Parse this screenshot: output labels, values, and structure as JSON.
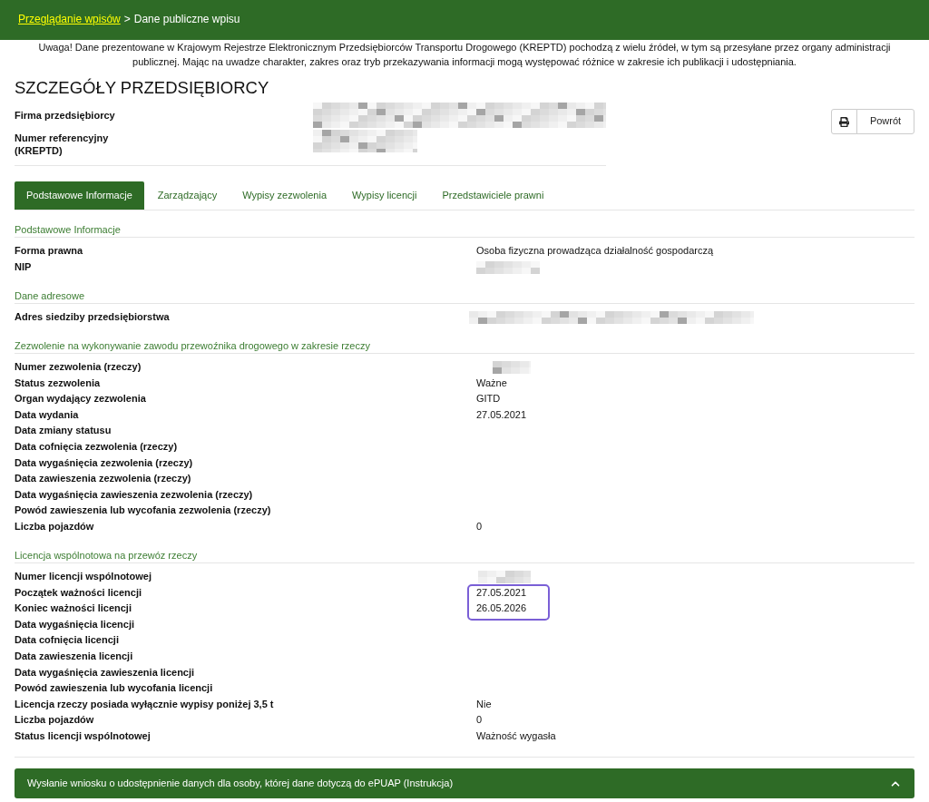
{
  "breadcrumb": {
    "link": "Przeglądanie wpisów",
    "separator": ">",
    "current": "Dane publiczne wpisu"
  },
  "notice": "Uwaga! Dane prezentowane w Krajowym Rejestrze Elektronicznym Przedsiębiorców Transportu Drogowego (KREPTD) pochodzą z wielu źródeł, w tym są przesyłane przez organy administracji publicznej. Mając na uwadze charakter, zakres oraz tryb przekazywania informacji mogą występować różnice w zakresie ich publikacji i udostępniania.",
  "title": "SZCZEGÓŁY PRZEDSIĘBIORCY",
  "details": [
    {
      "label": "Firma przedsiębiorcy",
      "kind": "redacted"
    },
    {
      "label": "Numer referencyjny (KREPTD)",
      "kind": "redacted"
    }
  ],
  "actions": [
    {
      "kind": "print"
    },
    {
      "kind": "text",
      "label": "Powrót"
    }
  ],
  "tabs": [
    {
      "label": "Podstawowe Informacje",
      "selected": true
    },
    {
      "label": "Zarządzający",
      "selected": false
    },
    {
      "label": "Wypisy zezwolenia",
      "selected": false
    },
    {
      "label": "Wypisy licencji",
      "selected": false
    },
    {
      "label": "Przedstawiciele prawni",
      "selected": false
    }
  ],
  "sections": [
    {
      "title": "Podstawowe Informacje",
      "rows": [
        {
          "label": "Forma prawna",
          "kind": "text",
          "value": "Osoba fizyczna prowadząca działalność gospodarczą",
          "highlighted": false
        },
        {
          "label": "NIP",
          "kind": "redacted",
          "highlighted": false
        }
      ]
    },
    {
      "title": "Dane adresowe",
      "rows": [
        {
          "label": "Adres siedziby przedsiębiorstwa",
          "kind": "redacted",
          "highlighted": false
        }
      ]
    },
    {
      "title": "Zezwolenie na wykonywanie zawodu przewoźnika drogowego w zakresie rzeczy",
      "rows": [
        {
          "label": "Numer zezwolenia (rzeczy)",
          "kind": "redacted",
          "highlighted": false
        },
        {
          "label": "Status zezwolenia",
          "kind": "text",
          "value": "Ważne",
          "highlighted": false
        },
        {
          "label": "Organ wydający zezwolenia",
          "kind": "text",
          "value": "GITD",
          "highlighted": false
        },
        {
          "label": "Data wydania",
          "kind": "text",
          "value": "27.05.2021",
          "highlighted": false
        },
        {
          "label": "Data zmiany statusu",
          "kind": "text",
          "highlighted": false
        },
        {
          "label": "Data cofnięcia zezwolenia (rzeczy)",
          "kind": "text",
          "highlighted": false
        },
        {
          "label": "Data wygaśnięcia zezwolenia (rzeczy)",
          "kind": "text",
          "highlighted": false
        },
        {
          "label": "Data zawieszenia zezwolenia (rzeczy)",
          "kind": "text",
          "highlighted": false
        },
        {
          "label": "Data wygaśnięcia zawieszenia zezwolenia (rzeczy)",
          "kind": "text",
          "highlighted": false
        },
        {
          "label": "Powód zawieszenia lub wycofania zezwolenia (rzeczy)",
          "kind": "text",
          "highlighted": false
        },
        {
          "label": "Liczba pojazdów",
          "kind": "text",
          "value": "0",
          "highlighted": false
        }
      ]
    },
    {
      "title": "Licencja wspólnotowa na przewóz rzeczy",
      "rows": [
        {
          "label": "Numer licencji wspólnotowej",
          "kind": "redacted",
          "highlighted": false
        },
        {
          "label": "Początek ważności licencji",
          "kind": "text",
          "value": "27.05.2021",
          "highlighted": true
        },
        {
          "label": "Koniec ważności licencji",
          "kind": "text",
          "value": "26.05.2026",
          "highlighted": true
        },
        {
          "label": "Data wygaśnięcia licencji",
          "kind": "text",
          "highlighted": false
        },
        {
          "label": "Data cofnięcia licencji",
          "kind": "text",
          "highlighted": false
        },
        {
          "label": "Data zawieszenia licencji",
          "kind": "text",
          "highlighted": false
        },
        {
          "label": "Data wygaśnięcia zawieszenia licencji",
          "kind": "text",
          "highlighted": false
        },
        {
          "label": "Powód zawieszenia lub wycofania licencji",
          "kind": "text",
          "highlighted": false
        },
        {
          "label": "Licencja rzeczy posiada wyłącznie wypisy poniżej 3,5 t",
          "kind": "text",
          "value": "Nie",
          "highlighted": false
        },
        {
          "label": "Liczba pojazdów",
          "kind": "text",
          "value": "0",
          "highlighted": false
        },
        {
          "label": "Status licencji wspólnotowej",
          "kind": "text",
          "value": "Ważność wygasła",
          "highlighted": false
        }
      ]
    }
  ],
  "accordion": {
    "title": "Wysłanie wniosku o udostępnienie danych dla osoby, której dane dotyczą do ePUAP (Instrukcja)"
  }
}
